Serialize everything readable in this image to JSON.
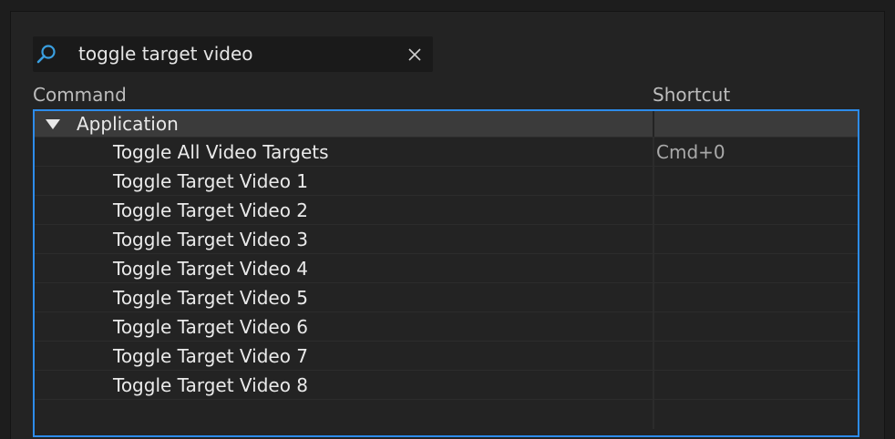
{
  "search": {
    "value": "toggle target video",
    "icon": "search-icon",
    "clear_icon": "close-icon"
  },
  "columns": {
    "command": "Command",
    "shortcut": "Shortcut"
  },
  "groups": [
    {
      "label": "Application",
      "expanded": true,
      "rows": [
        {
          "command": "Toggle All Video Targets",
          "shortcut": "Cmd+0"
        },
        {
          "command": "Toggle Target Video 1",
          "shortcut": ""
        },
        {
          "command": "Toggle Target Video 2",
          "shortcut": ""
        },
        {
          "command": "Toggle Target Video 3",
          "shortcut": ""
        },
        {
          "command": "Toggle Target Video 4",
          "shortcut": ""
        },
        {
          "command": "Toggle Target Video 5",
          "shortcut": ""
        },
        {
          "command": "Toggle Target Video 6",
          "shortcut": ""
        },
        {
          "command": "Toggle Target Video 7",
          "shortcut": ""
        },
        {
          "command": "Toggle Target Video 8",
          "shortcut": ""
        }
      ]
    }
  ],
  "colors": {
    "accent": "#2d8ceb",
    "search_icon": "#3a9fe0"
  }
}
